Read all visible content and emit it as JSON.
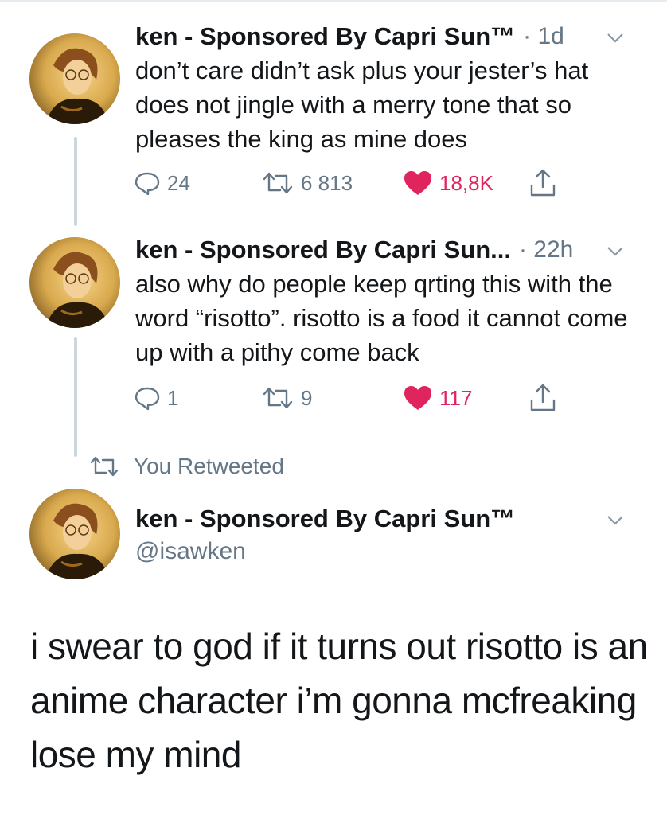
{
  "tweets": [
    {
      "display_name": "ken - Sponsored By Capri Sun™",
      "time": "· 1d",
      "text": "don’t care didn’t ask plus your jester’s hat does not jingle with a merry tone that so pleases the king as mine does",
      "replies": "24",
      "retweets": "6 813",
      "likes": "18,8K"
    },
    {
      "display_name": "ken - Sponsored By Capri Sun...",
      "time": "· 22h",
      "text": "also why do people keep qrting this with the word “risotto”. risotto is a food it cannot come up with a pithy come back",
      "replies": "1",
      "retweets": "9",
      "likes": "117"
    }
  ],
  "retweeted_label": "You Retweeted",
  "main_tweet": {
    "display_name": "ken - Sponsored By Capri Sun™",
    "handle": "@isawken",
    "text": "i swear to god if it turns out risotto is an anime character i’m gonna mcfreaking lose my mind"
  },
  "colors": {
    "text": "#14171a",
    "secondary": "#657786",
    "like_active": "#e0245e",
    "thread_line": "#ccd6dd"
  },
  "icons": {
    "reply": "reply-icon",
    "retweet": "retweet-icon",
    "like": "heart-icon",
    "share": "share-icon",
    "menu": "chevron-down-icon"
  }
}
